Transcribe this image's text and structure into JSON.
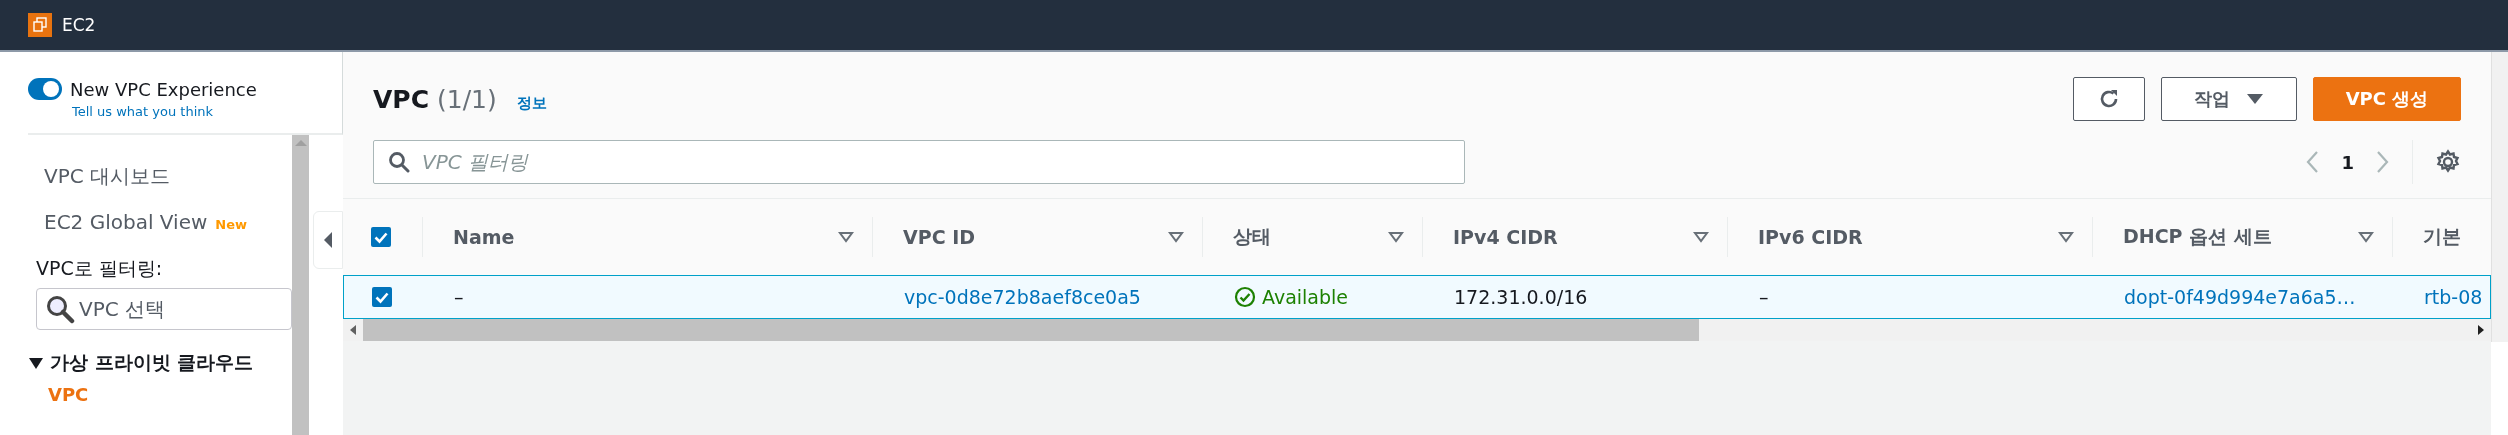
{
  "top_bar": {
    "service": "EC2"
  },
  "sidebar": {
    "toggle": {
      "label": "New VPC Experience",
      "on": true
    },
    "feedback_link": "Tell us what you think",
    "items": [
      {
        "label": "VPC 대시보드"
      },
      {
        "label": "EC2 Global View",
        "badge": "New"
      }
    ],
    "filter": {
      "label": "VPC로 필터링:",
      "placeholder": "VPC 선택"
    },
    "sections": [
      {
        "label": "가상 프라이빗 클라우드",
        "expanded": true,
        "children": [
          {
            "label": "VPC",
            "selected": true
          }
        ]
      }
    ]
  },
  "panel": {
    "title": "VPC",
    "count": "(1/1)",
    "info_link": "정보",
    "buttons": [
      {
        "kind": "refresh"
      },
      {
        "kind": "dropdown",
        "label": "작업"
      },
      {
        "kind": "primary",
        "label": "VPC 생성"
      }
    ],
    "search": {
      "placeholder": "VPC 필터링"
    },
    "pagination": {
      "page": "1"
    }
  },
  "table": {
    "all_selected": true,
    "columns": [
      {
        "label": "Name",
        "sortable": true
      },
      {
        "label": "VPC ID",
        "sortable": true
      },
      {
        "label": "상태",
        "sortable": true
      },
      {
        "label": "IPv4 CIDR",
        "sortable": true
      },
      {
        "label": "IPv6 CIDR",
        "sortable": true
      },
      {
        "label": "DHCP 옵션 세트",
        "sortable": true
      },
      {
        "label": "기본",
        "sortable": false
      }
    ],
    "rows": [
      {
        "selected": true,
        "cells": [
          {
            "kind": "text",
            "text": "–"
          },
          {
            "kind": "link",
            "text": "vpc-0d8e72b8aef8ce0a5"
          },
          {
            "kind": "status",
            "text": "Available"
          },
          {
            "kind": "text",
            "text": "172.31.0.0/16"
          },
          {
            "kind": "text",
            "text": "–"
          },
          {
            "kind": "link",
            "text": "dopt-0f49d994e7a6a5…"
          },
          {
            "kind": "link",
            "text": "rtb-08"
          }
        ]
      }
    ]
  }
}
